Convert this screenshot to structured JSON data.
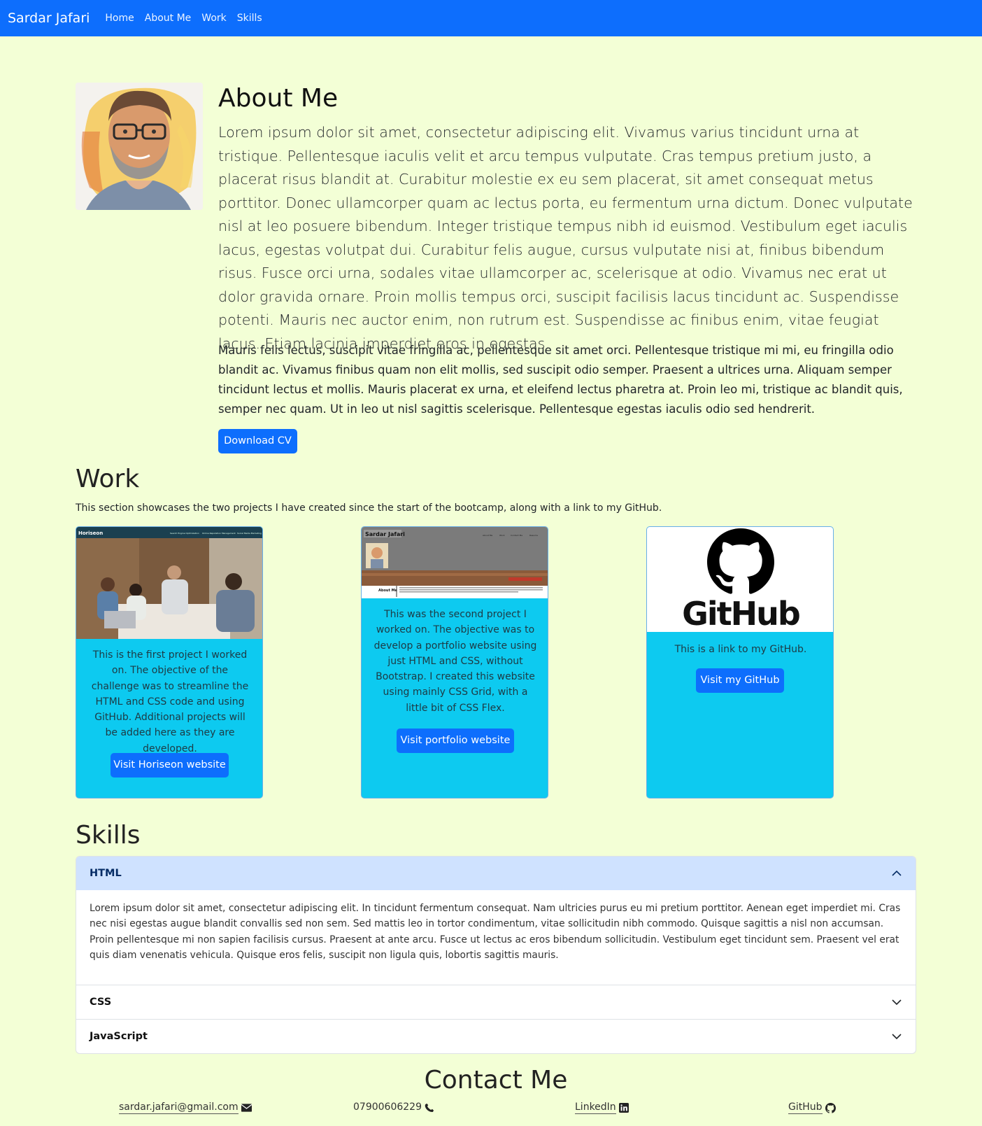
{
  "nav": {
    "brand": "Sardar Jafari",
    "links": [
      "Home",
      "About Me",
      "Work",
      "Skills"
    ]
  },
  "about": {
    "title": "About Me",
    "lead": "Lorem ipsum dolor sit amet, consectetur adipiscing elit. Vivamus varius tincidunt urna at tristique. Pellentesque iaculis velit et arcu tempus vulputate. Cras tempus pretium justo, a placerat risus blandit at. Curabitur molestie ex eu sem placerat, sit amet consequat metus porttitor. Donec ullamcorper quam ac lectus porta, eu fermentum urna dictum. Donec vulputate nisl at leo posuere bibendum. Integer tristique tempus nibh id euismod. Vestibulum eget iaculis lacus, egestas volutpat dui. Curabitur felis augue, cursus vulputate nisi at, finibus bibendum risus. Fusce orci urna, sodales vitae ullamcorper ac, scelerisque at odio. Vivamus nec erat ut dolor gravida ornare. Proin mollis tempus orci, suscipit facilisis lacus tincidunt ac. Suspendisse potenti. Mauris nec auctor enim, non rutrum est. Suspendisse ac finibus enim, vitae feugiat lacus. Etiam lacinia imperdiet eros in egestas.",
    "paragraph": "Mauris felis lectus, suscipit vitae fringilla ac, pellentesque sit amet orci. Pellentesque tristique mi mi, eu fringilla odio blandit ac. Vivamus finibus quam non elit mollis, sed suscipit odio semper. Praesent a ultrices urna. Aliquam semper tincidunt lectus et mollis. Mauris placerat ex urna, et eleifend lectus pharetra at. Proin leo mi, tristique ac blandit quis, semper nec quam. Ut in leo ut nisl sagittis scelerisque. Pellentesque egestas iaculis odio sed hendrerit.",
    "download_label": "Download CV"
  },
  "work": {
    "title": "Work",
    "description": "This section showcases the two projects I have created since the start of the bootcamp, along with a link to my GitHub.",
    "cards": [
      {
        "text": "This is the first project I worked on. The objective of the challenge was to streamline the HTML and CSS code and using GitHub. Additional projects will be added here as they are developed.",
        "button": "Visit Horiseon website",
        "thumb_brand": "Horiseon",
        "thumb_nav": [
          "Search Engine Optimization",
          "Online Reputation Management",
          "Social Media Marketing"
        ]
      },
      {
        "text": "This was the second project I worked on. The objective was to develop a portfolio website using just HTML and CSS, without Bootstrap. I created this website using mainly CSS Grid, with a little bit of CSS Flex.",
        "button": "Visit portfolio website",
        "thumb_brand": "Sardar Jafari",
        "thumb_nav": [
          "About Me",
          "Work",
          "Contact Me",
          "Resume"
        ],
        "thumb_section": "About Me"
      },
      {
        "text": "This is a link to my GitHub.",
        "button": "Visit my GitHub",
        "logo_text": "GitHub"
      }
    ]
  },
  "skills": {
    "title": "Skills",
    "items": [
      {
        "label": "HTML",
        "expanded": true,
        "body": "Lorem ipsum dolor sit amet, consectetur adipiscing elit. In tincidunt fermentum consequat. Nam ultricies purus eu mi pretium porttitor. Aenean eget imperdiet mi. Cras nec nisi egestas augue blandit convallis sed non sem. Sed mattis leo in tortor condimentum, vitae sollicitudin nibh commodo. Quisque sagittis a nisl non accumsan. Proin pellentesque mi non sapien facilisis cursus. Praesent at ante arcu. Fusce ut lectus ac eros bibendum sollicitudin. Vestibulum eget tincidunt sem. Praesent vel erat quis diam venenatis vehicula. Quisque eros felis, suscipit non ligula quis, lobortis sagittis mauris."
      },
      {
        "label": "CSS",
        "expanded": false
      },
      {
        "label": "JavaScript",
        "expanded": false
      }
    ]
  },
  "contact": {
    "title": "Contact Me",
    "items": [
      {
        "label": "sardar.jafari@gmail.com",
        "icon": "envelope-icon"
      },
      {
        "label": "07900606229",
        "icon": "phone-icon"
      },
      {
        "label": "LinkedIn",
        "icon": "linkedin-icon"
      },
      {
        "label": "GitHub",
        "icon": "github-icon"
      }
    ]
  },
  "colors": {
    "primary": "#0d6efd",
    "background": "#f3ffd6",
    "card": "#0dcaf0",
    "accordion_active": "#cfe2ff"
  }
}
